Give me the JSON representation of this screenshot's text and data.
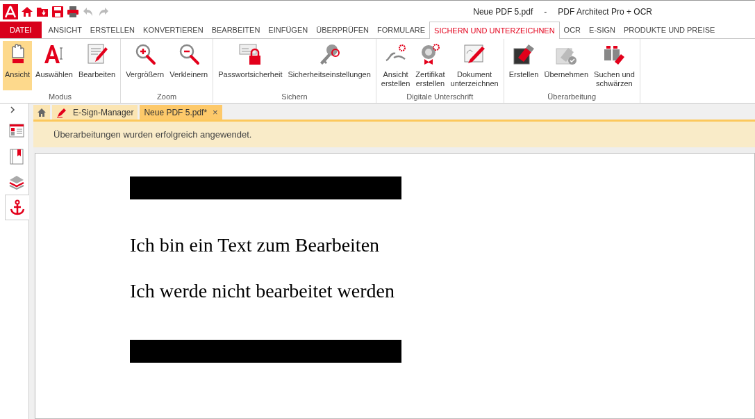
{
  "title": {
    "document": "Neue PDF 5.pdf",
    "separator": "-",
    "app": "PDF Architect Pro + OCR"
  },
  "menu_tabs": [
    {
      "label": "DATEI",
      "kind": "file",
      "selected": false
    },
    {
      "label": "ANSICHT",
      "kind": "tab",
      "selected": false
    },
    {
      "label": "ERSTELLEN",
      "kind": "tab",
      "selected": false
    },
    {
      "label": "KONVERTIEREN",
      "kind": "tab",
      "selected": false
    },
    {
      "label": "BEARBEITEN",
      "kind": "tab",
      "selected": false
    },
    {
      "label": "EINFÜGEN",
      "kind": "tab",
      "selected": false
    },
    {
      "label": "ÜBERPRÜFEN",
      "kind": "tab",
      "selected": false
    },
    {
      "label": "FORMULARE",
      "kind": "tab",
      "selected": false
    },
    {
      "label": "SICHERN UND UNTERZEICHNEN",
      "kind": "tab",
      "selected": true
    },
    {
      "label": "OCR",
      "kind": "tab",
      "selected": false
    },
    {
      "label": "E-SIGN",
      "kind": "tab",
      "selected": false
    },
    {
      "label": "PRODUKTE UND PREISE",
      "kind": "tab",
      "selected": false
    }
  ],
  "ribbon": {
    "groups": [
      {
        "label": "Modus",
        "buttons": [
          {
            "label": "Ansicht",
            "selected": true
          },
          {
            "label": "Auswählen",
            "selected": false
          },
          {
            "label": "Bearbeiten",
            "selected": false
          }
        ]
      },
      {
        "label": "Zoom",
        "buttons": [
          {
            "label": "Vergrößern",
            "selected": false
          },
          {
            "label": "Verkleinern",
            "selected": false
          }
        ]
      },
      {
        "label": "Sichern",
        "buttons": [
          {
            "label": "Passwortsicherheit",
            "selected": false
          },
          {
            "label": "Sicherheitseinstellungen",
            "selected": false
          }
        ]
      },
      {
        "label": "Digitale Unterschrift",
        "buttons": [
          {
            "label": "Ansicht\nerstellen",
            "selected": false
          },
          {
            "label": "Zertifikat\nerstellen",
            "selected": false
          },
          {
            "label": "Dokument\nunterzeichnen",
            "selected": false
          }
        ]
      },
      {
        "label": "Überarbeitung",
        "buttons": [
          {
            "label": "Erstellen",
            "selected": false
          },
          {
            "label": "Übernehmen",
            "selected": false
          },
          {
            "label": "Suchen und\nschwärzen",
            "selected": false
          }
        ]
      }
    ]
  },
  "sidebar": {
    "items": [
      {
        "selected": false
      },
      {
        "selected": false
      },
      {
        "selected": false
      },
      {
        "selected": true
      }
    ]
  },
  "doc_tabs": [
    {
      "kind": "home",
      "selected": false
    },
    {
      "kind": "tab",
      "label": "E-Sign-Manager",
      "selected": false
    },
    {
      "kind": "tab",
      "label": "Neue PDF 5.pdf*",
      "selected": true,
      "close": "×"
    }
  ],
  "notification": "Überarbeitungen wurden erfolgreich angewendet.",
  "document": {
    "lines": [
      {
        "kind": "redaction"
      },
      {
        "kind": "text",
        "text": "Ich bin ein Text zum Bearbeiten"
      },
      {
        "kind": "text",
        "text": "Ich werde nicht bearbeitet werden"
      },
      {
        "kind": "redaction"
      }
    ]
  }
}
